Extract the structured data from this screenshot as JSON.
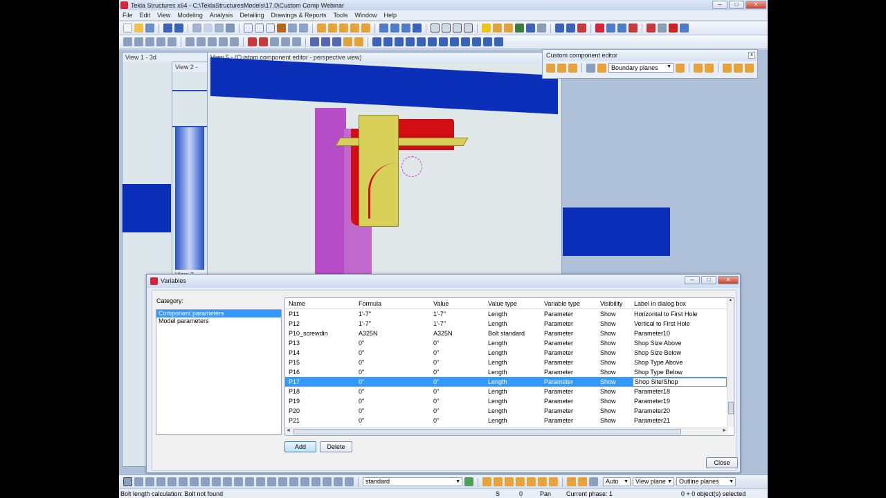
{
  "window": {
    "title": "Tekla Structures x64 - C:\\TeklaStructuresModels\\17.0\\Custom Comp Webinar",
    "minimize": "–",
    "maximize": "□",
    "close": "✕"
  },
  "menu": {
    "items": [
      "File",
      "Edit",
      "View",
      "Modeling",
      "Analysis",
      "Detailing",
      "Drawings & Reports",
      "Tools",
      "Window",
      "Help"
    ]
  },
  "views": {
    "view1_label": "View 1 - 3d",
    "view2_label": "View 2 -",
    "view5_label": "View 5 - (Custom component editor - perspective view)",
    "view3_label": "View 3"
  },
  "custom_component_editor": {
    "title": "Custom component editor",
    "close": "x",
    "select_value": "Boundary planes"
  },
  "variables_dialog": {
    "title": "Variables",
    "category_label": "Category:",
    "categories": [
      "Component parameters",
      "Model parameters"
    ],
    "selected_category": 0,
    "columns": {
      "name": "Name",
      "formula": "Formula",
      "value": "Value",
      "value_type": "Value type",
      "variable_type": "Variable type",
      "visibility": "Visibility",
      "label": "Label in dialog box"
    },
    "rows": [
      {
        "name": "P11",
        "formula": "1'-7\"",
        "value": "1'-7\"",
        "value_type": "Length",
        "variable_type": "Parameter",
        "visibility": "Show",
        "label": "Horizontal to First Hole"
      },
      {
        "name": "P12",
        "formula": "1'-7\"",
        "value": "1'-7\"",
        "value_type": "Length",
        "variable_type": "Parameter",
        "visibility": "Show",
        "label": "Vertical to First Hole"
      },
      {
        "name": "P10_screwdin",
        "formula": "A325N",
        "value": "A325N",
        "value_type": "Bolt standard",
        "variable_type": "Parameter",
        "visibility": "Show",
        "label": "Parameter10"
      },
      {
        "name": "P13",
        "formula": "0\"",
        "value": "0\"",
        "value_type": "Length",
        "variable_type": "Parameter",
        "visibility": "Show",
        "label": "Shop Size Above"
      },
      {
        "name": "P14",
        "formula": "0\"",
        "value": "0\"",
        "value_type": "Length",
        "variable_type": "Parameter",
        "visibility": "Show",
        "label": "Shop Size Below"
      },
      {
        "name": "P15",
        "formula": "0\"",
        "value": "0\"",
        "value_type": "Length",
        "variable_type": "Parameter",
        "visibility": "Show",
        "label": "Shop Type Above"
      },
      {
        "name": "P16",
        "formula": "0\"",
        "value": "0\"",
        "value_type": "Length",
        "variable_type": "Parameter",
        "visibility": "Show",
        "label": "Shop Type Below"
      },
      {
        "name": "P17",
        "formula": "0\"",
        "value": "0\"",
        "value_type": "Length",
        "variable_type": "Parameter",
        "visibility": "Show",
        "label": "Shop Site/Shop"
      },
      {
        "name": "P18",
        "formula": "0\"",
        "value": "0\"",
        "value_type": "Length",
        "variable_type": "Parameter",
        "visibility": "Show",
        "label": "Parameter18"
      },
      {
        "name": "P19",
        "formula": "0\"",
        "value": "0\"",
        "value_type": "Length",
        "variable_type": "Parameter",
        "visibility": "Show",
        "label": "Parameter19"
      },
      {
        "name": "P20",
        "formula": "0\"",
        "value": "0\"",
        "value_type": "Length",
        "variable_type": "Parameter",
        "visibility": "Show",
        "label": "Parameter20"
      },
      {
        "name": "P21",
        "formula": "0\"",
        "value": "0\"",
        "value_type": "Length",
        "variable_type": "Parameter",
        "visibility": "Show",
        "label": "Parameter21"
      }
    ],
    "selected_row": 7,
    "buttons": {
      "add": "Add",
      "delete": "Delete",
      "close": "Close"
    },
    "scroll_up": "▲",
    "scroll_left": "◄",
    "scroll_right": "►"
  },
  "bottom_toolbar": {
    "standard_select": "standard",
    "auto_select": "Auto",
    "view_plane_select": "View plane",
    "outline_planes_select": "Outline planes"
  },
  "statusbar": {
    "message": "Bolt length calculation: Bolt not found",
    "snap_s": "S",
    "snap_value": "0",
    "mode": "Pan",
    "phase": "Current phase: 1",
    "selection": "0 + 0 object(s) selected"
  },
  "colors": {
    "selection": "#3399ff",
    "beam_blue": "#0b2fb8",
    "column_magenta": "#b74cc7",
    "plate_red": "#d10e14",
    "plate_yellow": "#d8cf58"
  }
}
